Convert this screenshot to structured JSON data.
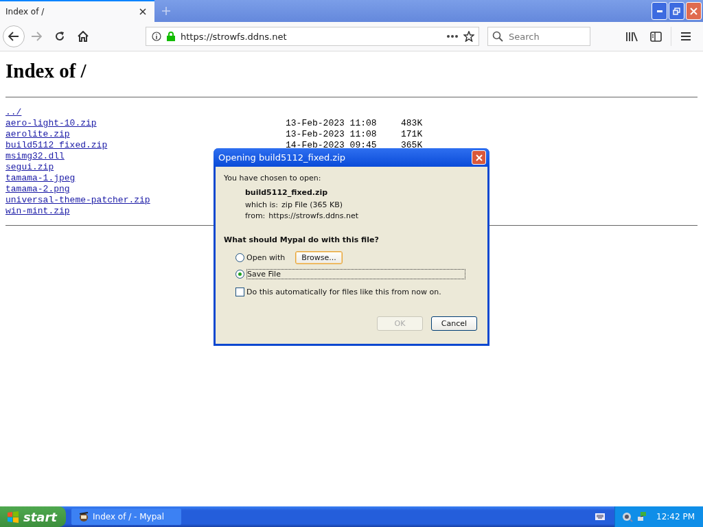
{
  "browser": {
    "tabs": [
      {
        "title": "Index of /",
        "selected": true
      }
    ],
    "address": "https://strowfs.ddns.net",
    "search": {
      "placeholder": "Search"
    }
  },
  "page": {
    "heading": "Index of /",
    "entries": [
      {
        "name": "../"
      },
      {
        "name": "aero-light-10.zip",
        "date": "13-Feb-2023 11:08",
        "size": "483K"
      },
      {
        "name": "aerolite.zip",
        "date": "13-Feb-2023 11:08",
        "size": "171K"
      },
      {
        "name": "build5112_fixed.zip",
        "date": "14-Feb-2023 09:45",
        "size": "365K"
      },
      {
        "name": "msimg32.dll"
      },
      {
        "name": "segui.zip"
      },
      {
        "name": "tamama-1.jpeg"
      },
      {
        "name": "tamama-2.png"
      },
      {
        "name": "universal-theme-patcher.zip"
      },
      {
        "name": "win-mint.zip"
      }
    ]
  },
  "dialog": {
    "title": "Opening build5112_fixed.zip",
    "intro": "You have chosen to open:",
    "file_name": "build5112_fixed.zip",
    "which_is_label": "which is:",
    "which_is": "zip File (365 KB)",
    "from_label": "from:",
    "from": "https://strowfs.ddns.net",
    "question": "What should Mypal do with this file?",
    "options": [
      {
        "label": "Open with",
        "selected": false,
        "button": "Browse..."
      },
      {
        "label": "Save File",
        "selected": true
      }
    ],
    "auto_checkbox": {
      "label": "Do this automatically for files like this from now on.",
      "checked": false
    },
    "buttons": [
      {
        "label": "OK",
        "disabled": true
      },
      {
        "label": "Cancel",
        "disabled": false
      }
    ]
  },
  "taskbar": {
    "start": "start",
    "tasks": [
      {
        "label": "Index of / - Mypal",
        "selected": false
      }
    ],
    "clock": "12:42 PM"
  }
}
